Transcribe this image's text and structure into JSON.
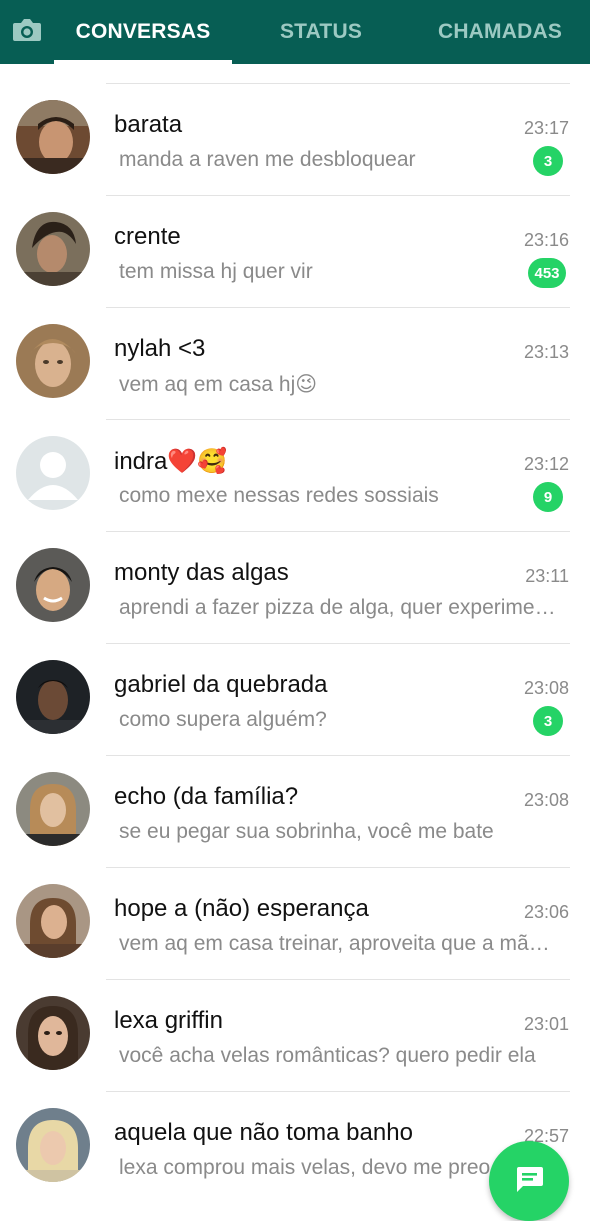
{
  "header": {
    "camera_icon": "camera-icon",
    "tabs": [
      {
        "label": "CONVERSAS",
        "active": true
      },
      {
        "label": "STATUS",
        "active": false
      },
      {
        "label": "CHAMADAS",
        "active": false
      }
    ]
  },
  "colors": {
    "header_bg": "#075e54",
    "accent": "#25d366",
    "inactive_tab": "#9cc9c2"
  },
  "chats": [
    {
      "name": "barata",
      "preview": "manda a raven me desbloquear",
      "time": "23:17",
      "unread": "3"
    },
    {
      "name": "crente",
      "preview": "tem missa hj quer vir",
      "time": "23:16",
      "unread": "453"
    },
    {
      "name": "nylah <3",
      "preview": "vem aq em casa hj😉",
      "time": "23:13",
      "unread": ""
    },
    {
      "name": "indra❤️🥰",
      "preview": "como mexe nessas redes sossiais",
      "time": "23:12",
      "unread": "9"
    },
    {
      "name": "monty das algas",
      "preview": "aprendi a fazer pizza de alga, quer experimentar?",
      "time": "23:11",
      "unread": ""
    },
    {
      "name": "gabriel da quebrada",
      "preview": "como supera alguém?",
      "time": "23:08",
      "unread": "3"
    },
    {
      "name": "echo (da família?",
      "preview": "se eu pegar sua sobrinha, você me bate",
      "time": "23:08",
      "unread": ""
    },
    {
      "name": "hope a (não) esperança",
      "preview": "vem aq em casa treinar, aproveita que a mãe saiu",
      "time": "23:06",
      "unread": ""
    },
    {
      "name": "lexa griffin",
      "preview": "você acha velas românticas? quero pedir ela",
      "time": "23:01",
      "unread": ""
    },
    {
      "name": "aquela que não toma banho",
      "preview": "lexa comprou mais velas, devo me preocupar",
      "time": "22:57",
      "unread": ""
    }
  ],
  "fab_icon": "new-chat-icon"
}
